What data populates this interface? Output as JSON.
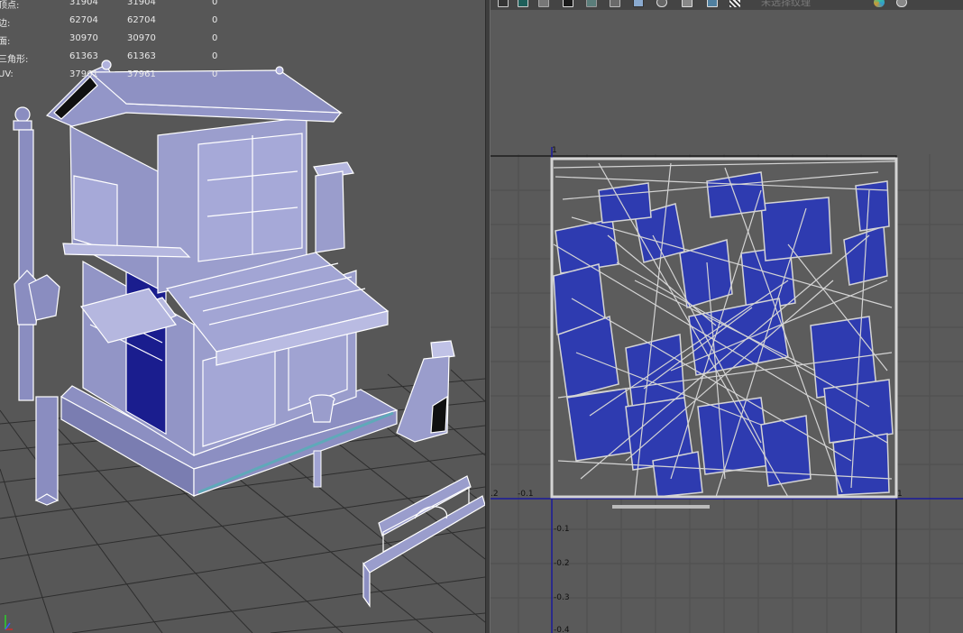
{
  "stats": {
    "rows": [
      {
        "label": "顶点:",
        "v1": "31904",
        "v2": "31904",
        "v3": "0"
      },
      {
        "label": "边:",
        "v1": "62704",
        "v2": "62704",
        "v3": "0"
      },
      {
        "label": "面:",
        "v1": "30970",
        "v2": "30970",
        "v3": "0"
      },
      {
        "label": "三角形:",
        "v1": "61363",
        "v2": "61363",
        "v3": "0"
      },
      {
        "label": "UV:",
        "v1": "37961",
        "v2": "37961",
        "v3": "0"
      }
    ]
  },
  "uv_toolbar": {
    "field_placeholder": "未选择纹理",
    "icons": [
      "grid-icon",
      "uv-shell-icon",
      "checker-icon",
      "texture-display-icon",
      "image-icon",
      "dim-icon",
      "filter-icon",
      "snapshot-icon",
      "frame-icon",
      "checker-pattern-icon",
      "color-wheel-icon",
      "settings-icon"
    ]
  },
  "uv_axes": {
    "top_label": "1",
    "right_label": "1",
    "x_labels": [
      ".2",
      "-0.1"
    ],
    "y_labels": [
      "-0.1",
      "-0.2",
      "-0.3",
      "-0.4"
    ]
  },
  "colors": {
    "viewport_bg": "#575757",
    "mesh_fill": "#8c8fc2",
    "wire": "#ffffff",
    "uv_shell": "#2e3bb0",
    "uv_wire": "#d4d4d4",
    "uv_bg": "#5a5a5a",
    "axis_blue": "#1a1a9a"
  }
}
